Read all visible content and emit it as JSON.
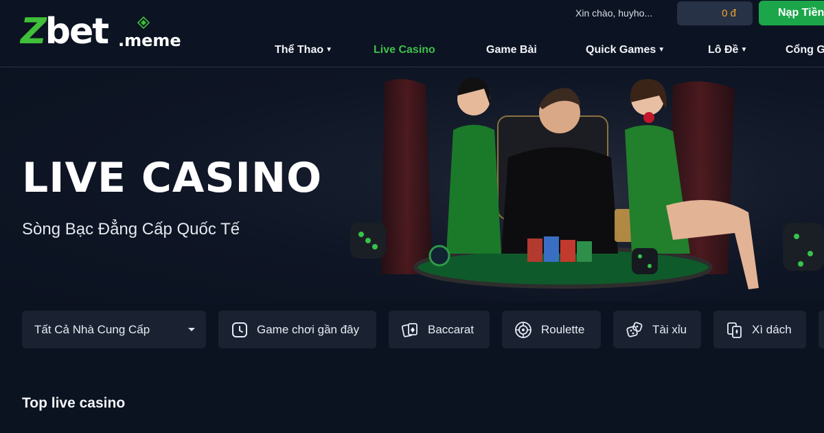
{
  "brand": {
    "logo_main": "Zbet",
    "logo_suffix": ".meme",
    "accent": "#3fbf3a"
  },
  "header": {
    "greeting": "Xin chào, huyho...",
    "balance": "0 đ",
    "deposit_label": "Nạp Tiền",
    "nav": [
      {
        "label": "Thể Thao",
        "has_dropdown": true,
        "active": false
      },
      {
        "label": "Live Casino",
        "has_dropdown": false,
        "active": true
      },
      {
        "label": "Game Bài",
        "has_dropdown": false,
        "active": false
      },
      {
        "label": "Quick Games",
        "has_dropdown": true,
        "active": false
      },
      {
        "label": "Lô Đề",
        "has_dropdown": true,
        "active": false
      },
      {
        "label": "Cổng Game",
        "has_dropdown": false,
        "active": false
      }
    ]
  },
  "hero": {
    "title": "LIVE CASINO",
    "subtitle": "Sòng Bạc Đẳng Cấp Quốc Tế"
  },
  "filters": {
    "provider_select": "Tất Cả Nhà Cung Cấp",
    "categories": [
      {
        "label": "Game chơi gần đây",
        "icon": "clock-icon"
      },
      {
        "label": "Baccarat",
        "icon": "cards-icon"
      },
      {
        "label": "Roulette",
        "icon": "roulette-icon"
      },
      {
        "label": "Tài xỉu",
        "icon": "dice-icon"
      },
      {
        "label": "Xì dách",
        "icon": "blackjack-icon"
      }
    ]
  },
  "section": {
    "title": "Top live casino"
  }
}
